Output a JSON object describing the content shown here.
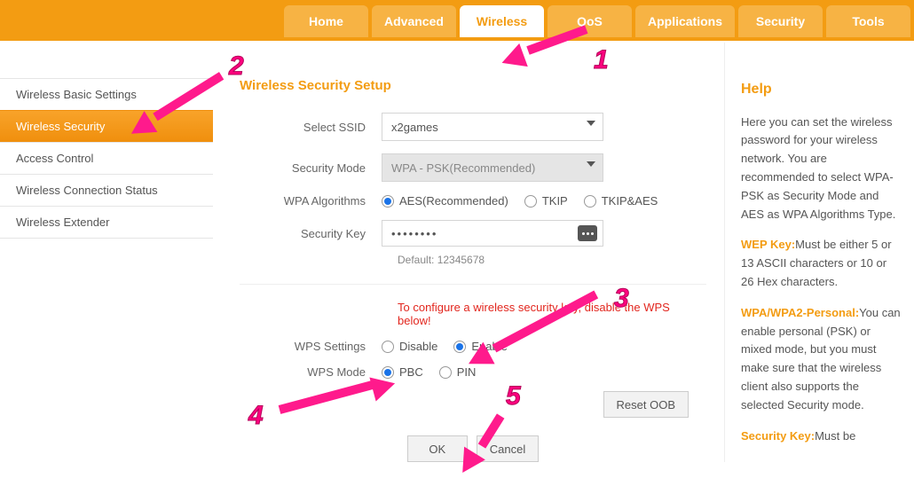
{
  "tabs": {
    "home": "Home",
    "advanced": "Advanced",
    "wireless": "Wireless",
    "qos": "QoS",
    "applications": "Applications",
    "security": "Security",
    "tools": "Tools"
  },
  "sidebar": {
    "items": [
      "Wireless Basic Settings",
      "Wireless Security",
      "Access Control",
      "Wireless Connection Status",
      "Wireless Extender"
    ]
  },
  "main": {
    "title": "Wireless Security Setup",
    "labels": {
      "select_ssid": "Select SSID",
      "security_mode": "Security Mode",
      "wpa_algorithms": "WPA Algorithms",
      "security_key": "Security Key",
      "wps_settings": "WPS Settings",
      "wps_mode": "WPS Mode"
    },
    "values": {
      "ssid": "x2games",
      "security_mode": "WPA - PSK(Recommended)",
      "alg_aes": "AES(Recommended)",
      "alg_tkip": "TKIP",
      "alg_tkip_aes": "TKIP&AES",
      "key_mask": "••••••••",
      "default_hint": "Default: 12345678",
      "wps_disable": "Disable",
      "wps_enable": "Enable",
      "wps_pbc": "PBC",
      "wps_pin": "PIN"
    },
    "warning": "To configure a wireless security key, disable the WPS below!",
    "buttons": {
      "reset_oob": "Reset OOB",
      "ok": "OK",
      "cancel": "Cancel"
    }
  },
  "help": {
    "title": "Help",
    "intro": "Here you can set the wireless password for your wireless network. You are recommended to select WPA-PSK as Security Mode and AES as WPA Algorithms Type.",
    "wep_label": "WEP Key:",
    "wep_text": "Must be either 5 or 13 ASCII characters or 10 or 26 Hex characters.",
    "wpa_label": "WPA/WPA2-Personal:",
    "wpa_text": "You can enable personal (PSK) or mixed mode, but you must make sure that the wireless client also supports the selected Security mode.",
    "sk_label": "Security Key:",
    "sk_text": "Must be"
  },
  "annotations": {
    "n1": "1",
    "n2": "2",
    "n3": "3",
    "n4": "4",
    "n5": "5"
  }
}
